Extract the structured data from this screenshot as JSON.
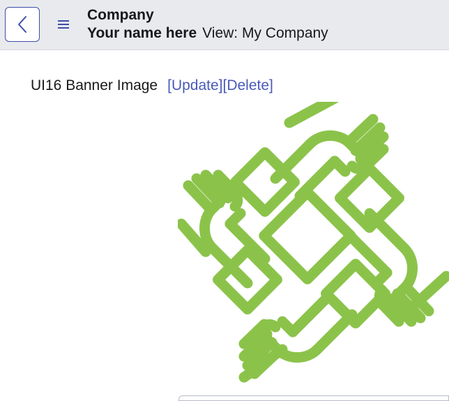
{
  "header": {
    "title": "Company",
    "user_name": "Your name here",
    "view_label": "View: My Company",
    "back_icon": "chevron-left-icon",
    "menu_icon": "hamburger-icon"
  },
  "field": {
    "label": "UI16 Banner Image",
    "update_link": "[Update]",
    "delete_link": "[Delete]"
  },
  "banner": {
    "image": "hands-holding-circle-logo",
    "color": "#8bc34a"
  },
  "colors": {
    "accent": "#4a5ab8",
    "header_bg": "#e9eaee"
  }
}
